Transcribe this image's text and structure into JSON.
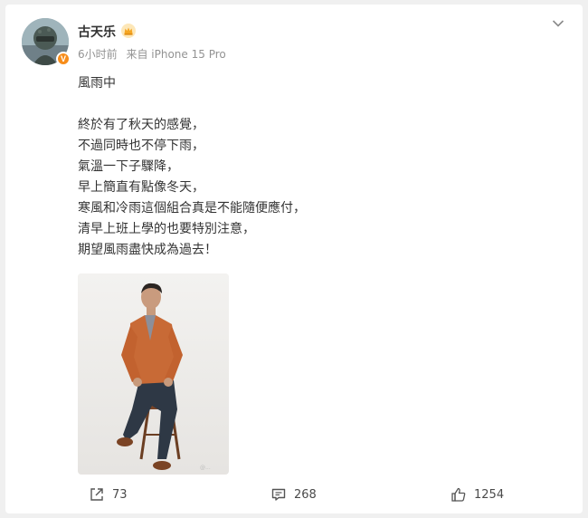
{
  "post": {
    "author": {
      "name": "古天乐",
      "verified_badge": "V",
      "avatar_icon": "avatar-soldier-image",
      "crown_icon": "crown-icon"
    },
    "meta": {
      "time": "6小时前",
      "source": "来自 iPhone 15 Pro"
    },
    "text_lines": [
      "風雨中",
      "",
      "終於有了秋天的感覺，",
      "不過同時也不停下雨，",
      "氣溫一下子驟降，",
      "早上簡直有點像冬天，",
      "寒風和冷雨這個組合真是不能隨便應付，",
      "清早上班上學的也要特別注意，",
      "期望風雨盡快成為過去！"
    ],
    "image": {
      "icon": "man-in-orange-jacket-photo"
    }
  },
  "actions": {
    "share_count": "73",
    "comment_count": "268",
    "like_count": "1254"
  },
  "colors": {
    "background": "#f0f0f0",
    "card": "#ffffff",
    "text": "#333333",
    "meta": "#939393",
    "badge": "#f78d1a"
  }
}
